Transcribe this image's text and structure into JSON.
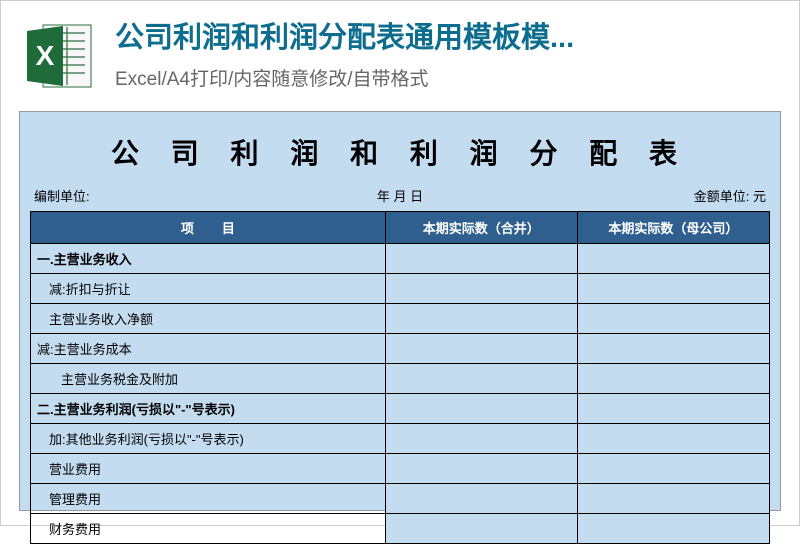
{
  "header": {
    "title": "公司利润和利润分配表通用模板模...",
    "subtitle": "Excel/A4打印/内容随意修改/自带格式"
  },
  "icon": {
    "name": "excel-icon"
  },
  "sheet": {
    "title": "公 司 利 润 和 利 润 分 配 表",
    "metaLeft": "编制单位:",
    "metaMid": "年 月 日",
    "metaRight": "金额单位:  元",
    "headers": {
      "item": "项",
      "itemSuffix": "目",
      "col2": "本期实际数（合并）",
      "col3": "本期实际数（母公司）"
    },
    "rows": [
      {
        "label": "一.主营业务收入",
        "bold": true,
        "indent": 0
      },
      {
        "label": "减:折扣与折让",
        "bold": false,
        "indent": 1
      },
      {
        "label": "主营业务收入净额",
        "bold": false,
        "indent": 1
      },
      {
        "label": "减:主营业务成本",
        "bold": false,
        "indent": 0
      },
      {
        "label": "主营业务税金及附加",
        "bold": false,
        "indent": 2
      },
      {
        "label": "二.主营业务利润(亏损以\"-\"号表示)",
        "bold": true,
        "indent": 0
      },
      {
        "label": "加:其他业务利润(亏损以\"-\"号表示)",
        "bold": false,
        "indent": 1
      },
      {
        "label": "营业费用",
        "bold": false,
        "indent": 1
      },
      {
        "label": "管理费用",
        "bold": false,
        "indent": 1
      },
      {
        "label": "财务费用",
        "bold": false,
        "indent": 1
      }
    ]
  }
}
